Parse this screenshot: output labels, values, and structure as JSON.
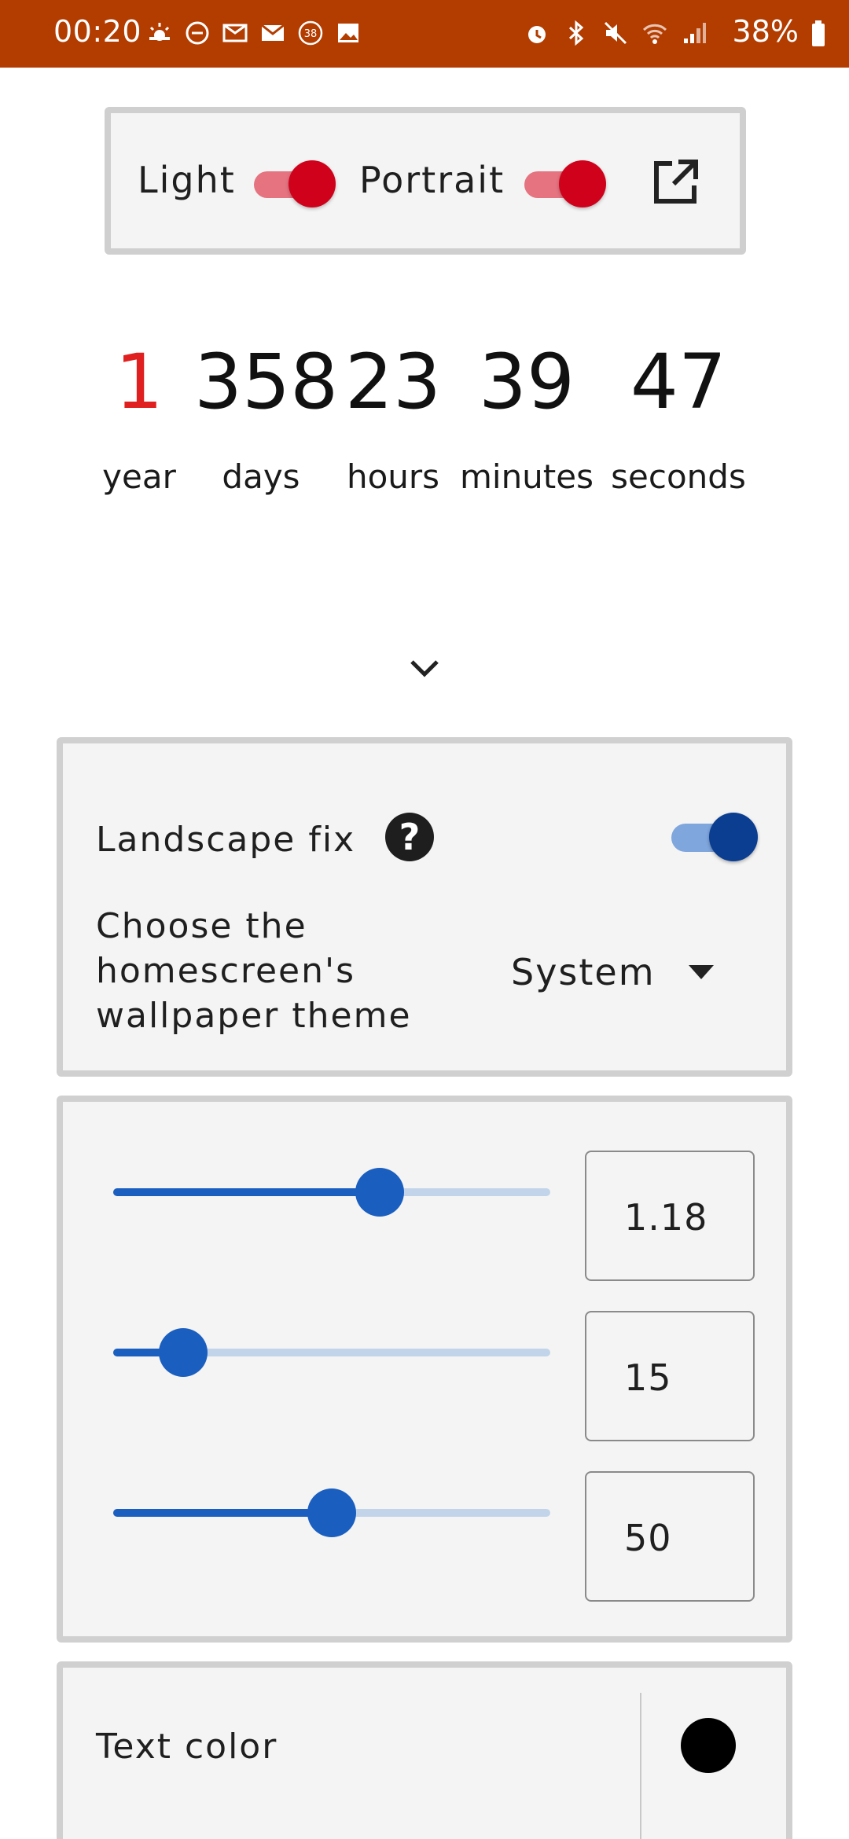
{
  "status_bar": {
    "time": "00:20",
    "battery": "38%",
    "bg_color": "#b33c00",
    "left_icons": [
      "weather-icon",
      "dnd-icon",
      "mail-icon",
      "email-icon",
      "notification-count-icon",
      "gallery-icon"
    ],
    "notification_count": "38",
    "right_icons": [
      "alarm-icon",
      "bluetooth-icon",
      "mute-icon",
      "wifi-icon",
      "signal-icon",
      "battery-icon"
    ]
  },
  "top_card": {
    "light_label": "Light",
    "light_toggle_on": true,
    "portrait_label": "Portrait",
    "portrait_toggle_on": true,
    "toggle_color": "#d0021b",
    "toggle_track_color": "#e57380",
    "open_icon": "open-in-new-icon"
  },
  "countdown": {
    "year": {
      "value": "1",
      "label": "year",
      "color": "#e02020"
    },
    "days": {
      "value": "358",
      "label": "days"
    },
    "hours": {
      "value": "23",
      "label": "hours"
    },
    "minutes": {
      "value": "39",
      "label": "minutes"
    },
    "seconds": {
      "value": "47",
      "label": "seconds"
    }
  },
  "expand_icon": "chevron-down-icon",
  "settings": {
    "landscape_fix_label": "Landscape fix",
    "landscape_fix_on": true,
    "help_icon": "help-icon",
    "theme_label_lines": [
      "Choose the",
      "homescreen's",
      "wallpaper theme"
    ],
    "theme_value": "System",
    "accent_color": "#0b3e91"
  },
  "sliders": [
    {
      "value": "1.18",
      "fraction": 0.61
    },
    {
      "value": "15",
      "fraction": 0.16
    },
    {
      "value": "50",
      "fraction": 0.5
    }
  ],
  "text_color": {
    "label": "Text color",
    "swatch": "#000000"
  }
}
